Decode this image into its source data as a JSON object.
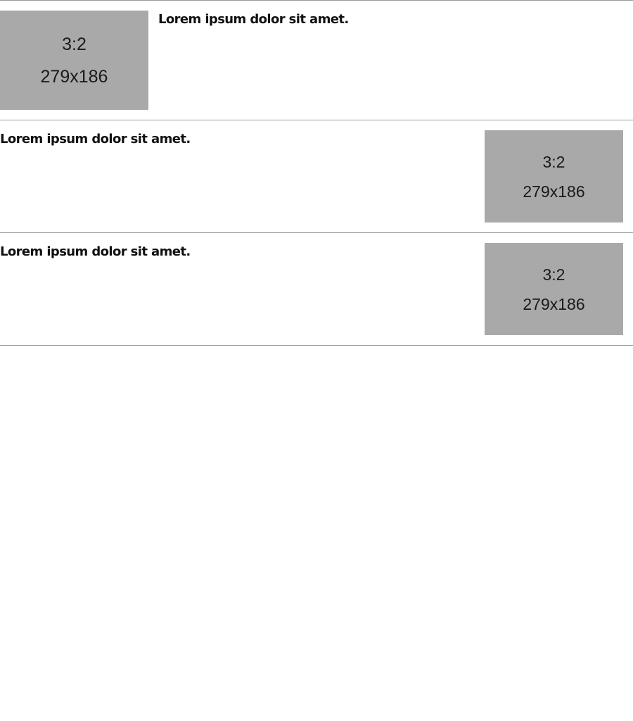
{
  "items": [
    {
      "title": "Lorem ipsum dolor sit amet.",
      "thumbnail": {
        "ratio": "3:2",
        "dimensions": "279x186"
      }
    },
    {
      "title": "Lorem ipsum dolor sit amet.",
      "thumbnail": {
        "ratio": "3:2",
        "dimensions": "279x186"
      }
    },
    {
      "title": "Lorem ipsum dolor sit amet.",
      "thumbnail": {
        "ratio": "3:2",
        "dimensions": "279x186"
      }
    }
  ],
  "colors": {
    "placeholder_background": "#a9a9a9",
    "divider": "#9a9a9a",
    "text": "#111111"
  }
}
